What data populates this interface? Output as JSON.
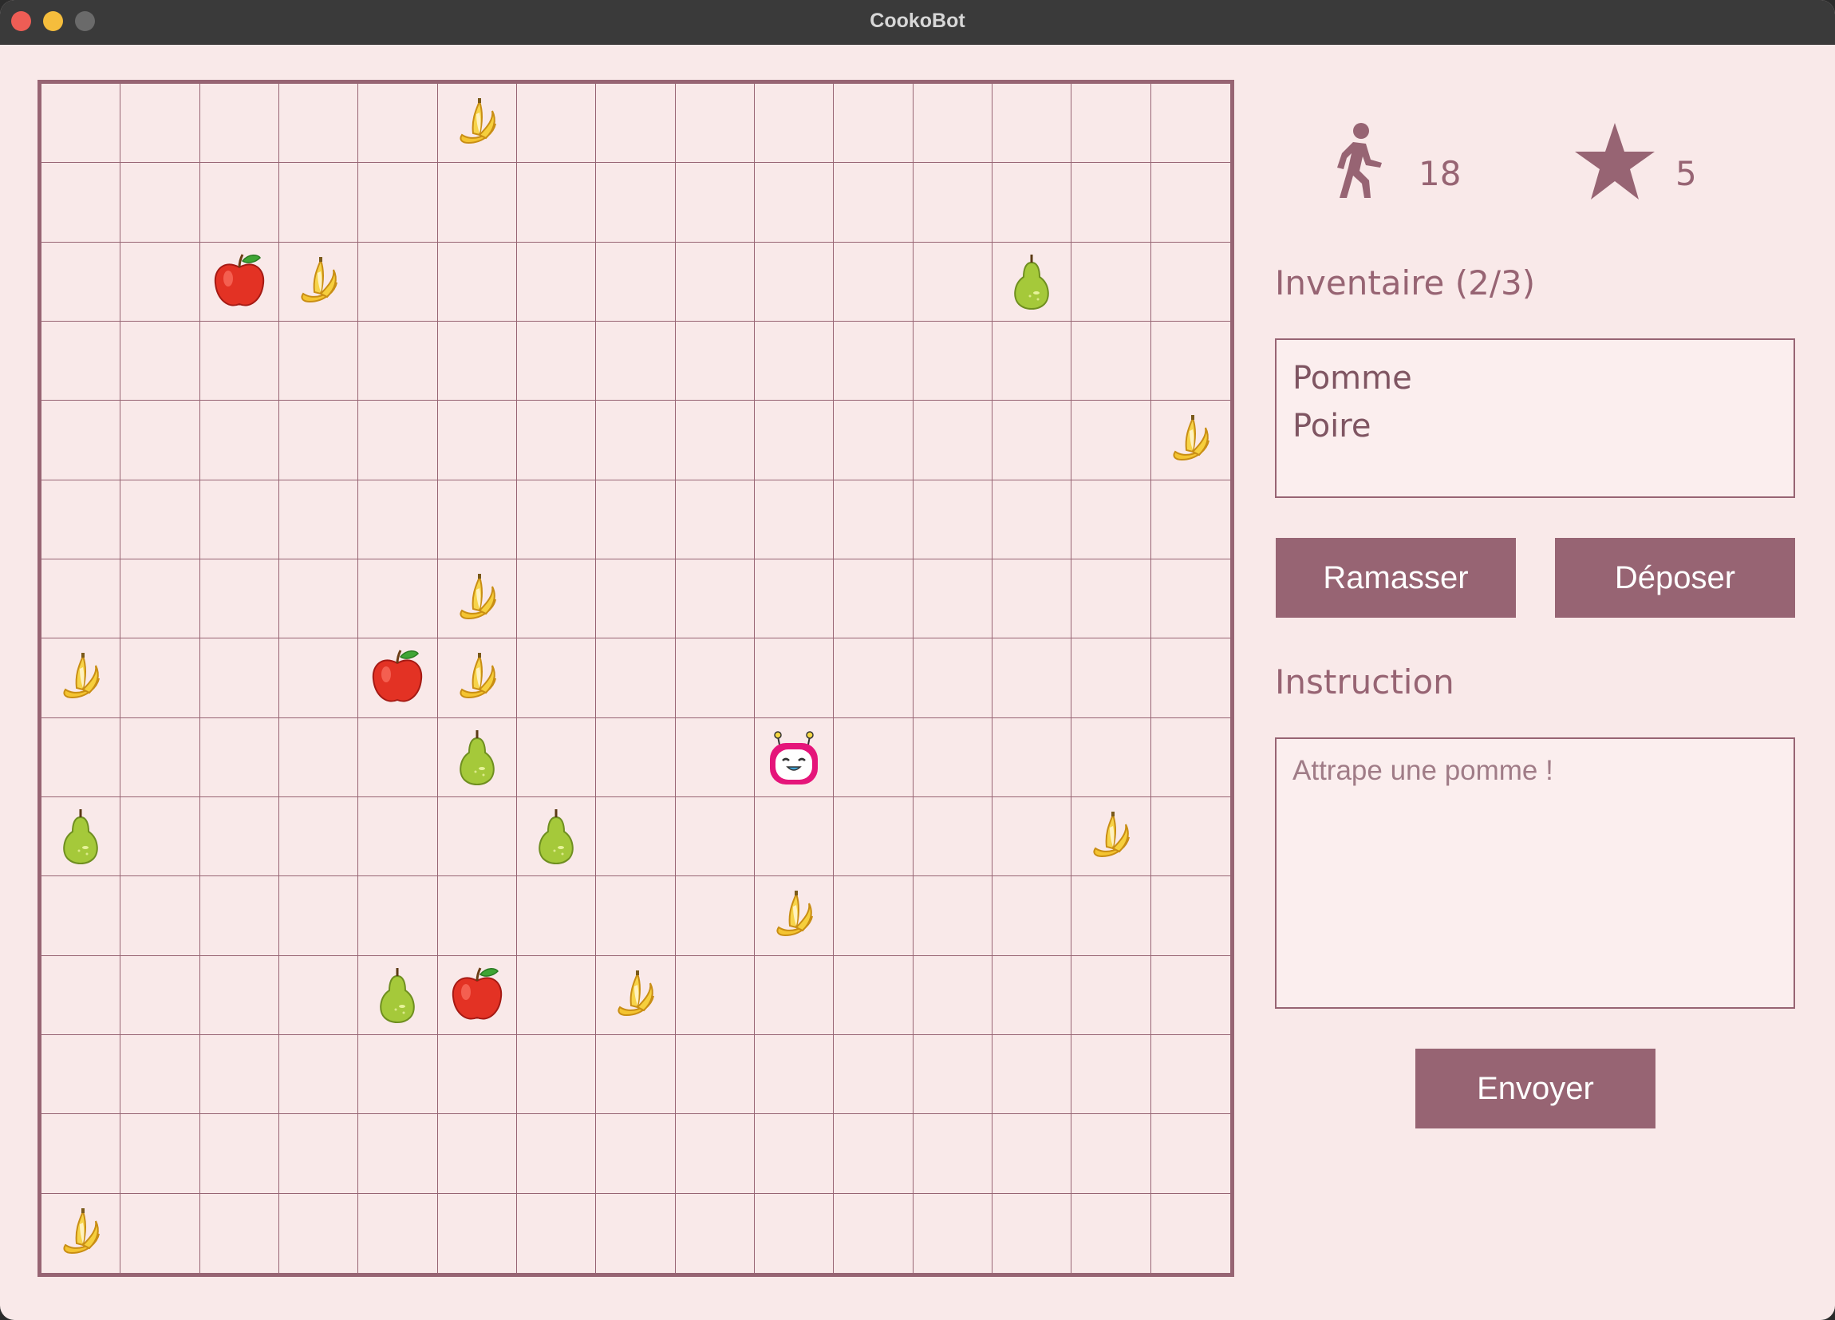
{
  "window": {
    "title": "CookoBot"
  },
  "board": {
    "rows": 15,
    "cols": 15,
    "items": [
      {
        "row": 0,
        "col": 5,
        "type": "banana"
      },
      {
        "row": 2,
        "col": 2,
        "type": "apple"
      },
      {
        "row": 2,
        "col": 3,
        "type": "banana"
      },
      {
        "row": 2,
        "col": 12,
        "type": "pear"
      },
      {
        "row": 4,
        "col": 14,
        "type": "banana"
      },
      {
        "row": 6,
        "col": 5,
        "type": "banana"
      },
      {
        "row": 7,
        "col": 0,
        "type": "banana"
      },
      {
        "row": 7,
        "col": 4,
        "type": "apple"
      },
      {
        "row": 7,
        "col": 5,
        "type": "banana"
      },
      {
        "row": 8,
        "col": 5,
        "type": "pear"
      },
      {
        "row": 9,
        "col": 0,
        "type": "pear"
      },
      {
        "row": 9,
        "col": 6,
        "type": "pear"
      },
      {
        "row": 9,
        "col": 13,
        "type": "banana"
      },
      {
        "row": 10,
        "col": 9,
        "type": "banana"
      },
      {
        "row": 11,
        "col": 4,
        "type": "pear"
      },
      {
        "row": 11,
        "col": 5,
        "type": "apple"
      },
      {
        "row": 11,
        "col": 7,
        "type": "banana"
      },
      {
        "row": 14,
        "col": 0,
        "type": "banana"
      }
    ],
    "robot": {
      "row": 8,
      "col": 9
    }
  },
  "stats": {
    "steps": "18",
    "steps_icon": "walking-person-icon",
    "score": "5",
    "score_icon": "star-icon"
  },
  "inventory": {
    "title": "Inventaire (2/3)",
    "items": [
      "Pomme",
      "Poire"
    ]
  },
  "actions": {
    "pickup_label": "Ramasser",
    "drop_label": "Déposer"
  },
  "instruction": {
    "title": "Instruction",
    "placeholder": "Attrape une pomme !",
    "send_label": "Envoyer"
  },
  "colors": {
    "accent": "#976473",
    "background": "#f9e9e9"
  }
}
